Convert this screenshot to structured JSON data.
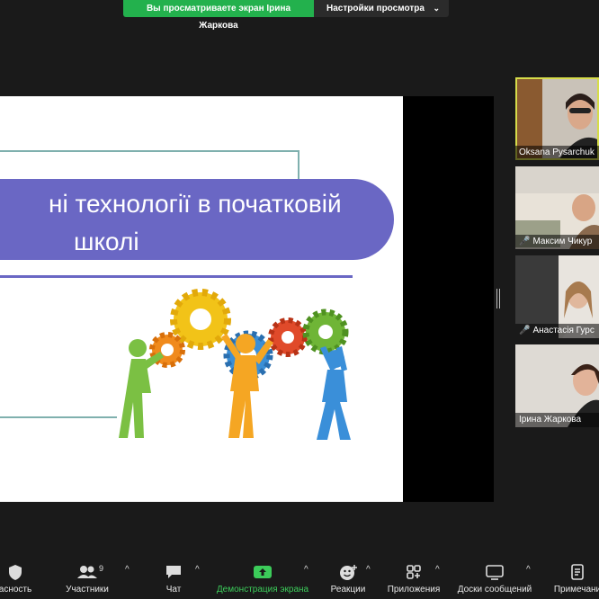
{
  "share_banner": {
    "viewing_text": "Вы просматриваете экран Ірина Жаркова",
    "view_settings_label": "Настройки просмотра",
    "view_settings_chevron": "⌄"
  },
  "slide": {
    "title_line1": "ні технології в початковій",
    "title_line2": "школі",
    "accent_color": "#6a67c4",
    "frame_color": "#7fb0ae"
  },
  "participants": [
    {
      "name": "Oksana Pysarchuk",
      "muted": false,
      "active": true
    },
    {
      "name": "Максим Чикур",
      "muted": true,
      "active": false
    },
    {
      "name": "Анастасія Гурс",
      "muted": true,
      "active": false
    },
    {
      "name": "Ірина Жаркова",
      "muted": false,
      "active": false
    }
  ],
  "toolbar": {
    "security_label": "асность",
    "participants_label": "Участники",
    "participants_count": "9",
    "chat_label": "Чат",
    "share_label": "Демонстрация экрана",
    "reactions_label": "Реакции",
    "apps_label": "Приложения",
    "whiteboards_label": "Доски сообщений",
    "notes_label": "Примечани",
    "caret": "^"
  },
  "icons": {
    "shield": "shield-icon",
    "participants": "people-icon",
    "chat": "chat-bubble-icon",
    "share": "share-screen-icon",
    "reactions": "emoji-icon",
    "apps": "apps-icon",
    "whiteboards": "whiteboard-icon",
    "notes": "notes-icon",
    "mic_muted": "mic-muted-icon"
  }
}
